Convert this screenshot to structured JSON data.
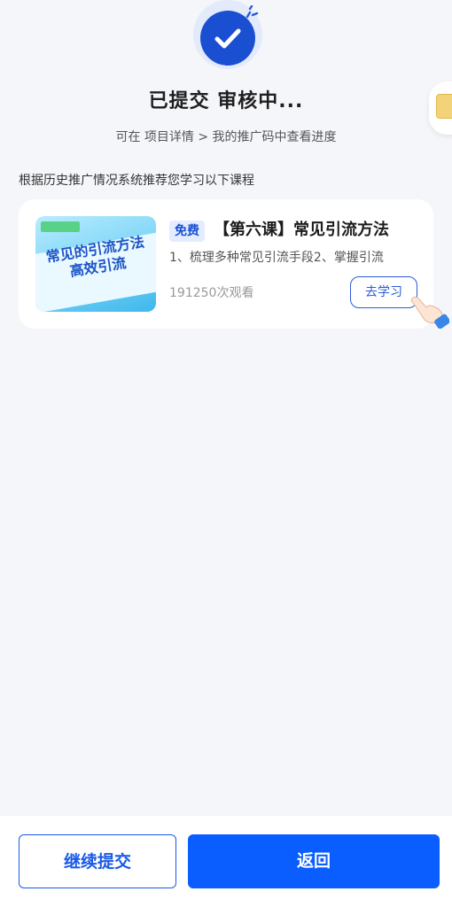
{
  "status": {
    "title": "已提交 审核中...",
    "hint": "可在 项目详情 > 我的推广码中查看进度",
    "icon": "check-circle-icon",
    "accent": "#1a4fd1"
  },
  "recommend": {
    "label": "根据历史推广情况系统推荐您学习以下课程",
    "course": {
      "tag": "免费",
      "title": "【第六课】常见引流方法",
      "description": "1、梳理多种常见引流手段2、掌握引流",
      "views": "191250次观看",
      "button_label": "去学习",
      "thumb_lines": [
        "常见的引流方法",
        "高效引流"
      ],
      "tag_color": "#e4ecff",
      "button_color": "#2a5bd7"
    }
  },
  "footer": {
    "continue_label": "继续提交",
    "back_label": "返回",
    "primary_color": "#0a5dff"
  }
}
